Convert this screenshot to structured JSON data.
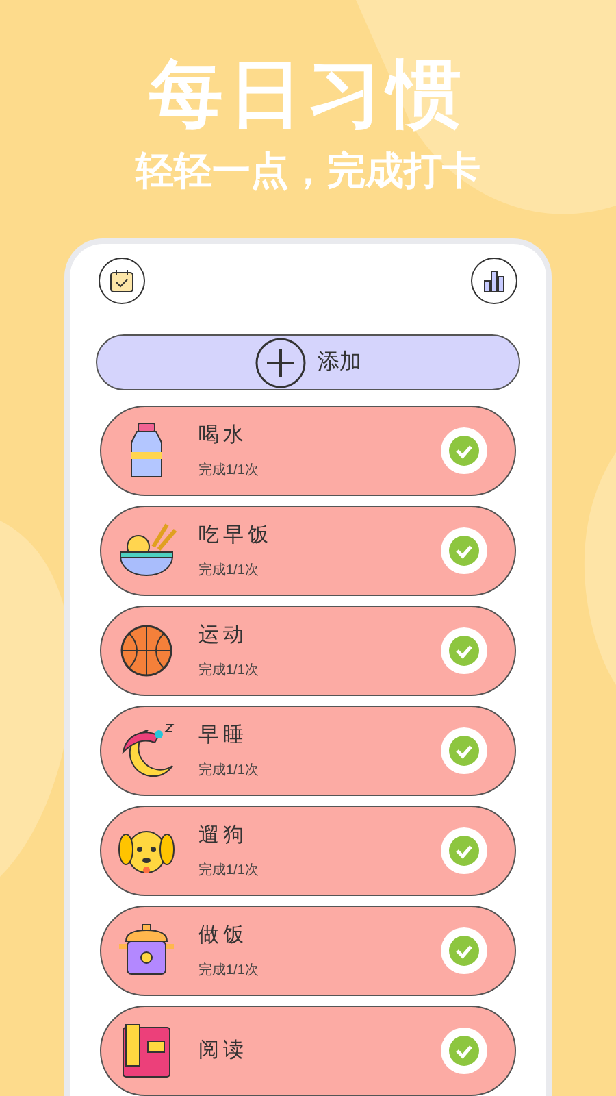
{
  "headline": "每日习惯",
  "tagline": "轻轻一点，完成打卡",
  "add_button": {
    "label": "添加"
  },
  "habits": [
    {
      "kind": "bottle",
      "name": "喝水",
      "progress": "完成1/1次",
      "done": true
    },
    {
      "kind": "bowl",
      "name": "吃早饭",
      "progress": "完成1/1次",
      "done": true
    },
    {
      "kind": "ball",
      "name": "运动",
      "progress": "完成1/1次",
      "done": true
    },
    {
      "kind": "moon",
      "name": "早睡",
      "progress": "完成1/1次",
      "done": true
    },
    {
      "kind": "dog",
      "name": "遛狗",
      "progress": "完成1/1次",
      "done": true
    },
    {
      "kind": "cooker",
      "name": "做饭",
      "progress": "完成1/1次",
      "done": true
    },
    {
      "kind": "book",
      "name": "阅读",
      "done": true
    }
  ]
}
